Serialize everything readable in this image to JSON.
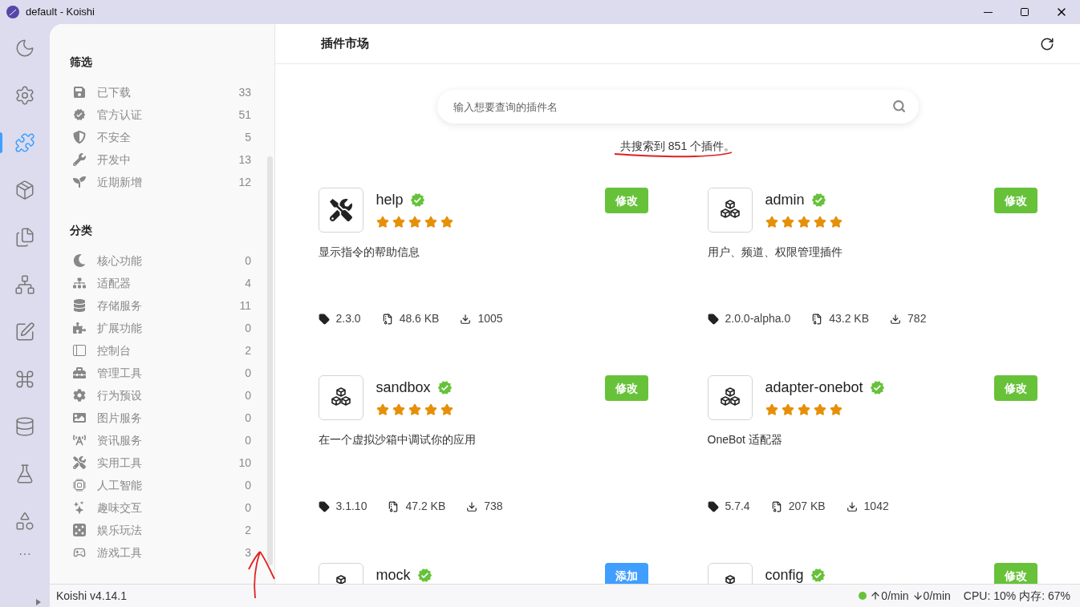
{
  "window": {
    "title": "default - Koishi"
  },
  "activity_bar": [
    {
      "selected": false
    },
    {
      "selected": false
    },
    {
      "selected": true
    },
    {
      "selected": false
    },
    {
      "selected": false
    },
    {
      "selected": false
    },
    {
      "selected": false
    },
    {
      "selected": false
    },
    {
      "selected": false
    },
    {
      "selected": false
    },
    {
      "selected": false
    }
  ],
  "more_label": "···",
  "sidebar": {
    "filter_title": "筛选",
    "filters": [
      {
        "label": "已下载",
        "count": "33"
      },
      {
        "label": "官方认证",
        "count": "51"
      },
      {
        "label": "不安全",
        "count": "5"
      },
      {
        "label": "开发中",
        "count": "13"
      },
      {
        "label": "近期新增",
        "count": "12"
      }
    ],
    "category_title": "分类",
    "categories": [
      {
        "label": "核心功能",
        "count": "0"
      },
      {
        "label": "适配器",
        "count": "4"
      },
      {
        "label": "存储服务",
        "count": "11"
      },
      {
        "label": "扩展功能",
        "count": "0"
      },
      {
        "label": "控制台",
        "count": "2"
      },
      {
        "label": "管理工具",
        "count": "0"
      },
      {
        "label": "行为预设",
        "count": "0"
      },
      {
        "label": "图片服务",
        "count": "0"
      },
      {
        "label": "资讯服务",
        "count": "0"
      },
      {
        "label": "实用工具",
        "count": "10"
      },
      {
        "label": "人工智能",
        "count": "0"
      },
      {
        "label": "趣味交互",
        "count": "0"
      },
      {
        "label": "娱乐玩法",
        "count": "2"
      },
      {
        "label": "游戏工具",
        "count": "3"
      }
    ]
  },
  "page": {
    "title": "插件市场",
    "search": {
      "placeholder": "输入想要查询的插件名"
    },
    "result_count": "共搜索到 851 个插件。"
  },
  "plugins": [
    {
      "name": "help",
      "kind": "tools",
      "verified": true,
      "stars": 5,
      "action": "修改",
      "installed": true,
      "description": "显示指令的帮助信息",
      "version": "2.3.0",
      "size": "48.6 KB",
      "downloads": "1005"
    },
    {
      "name": "admin",
      "kind": "cubes",
      "verified": true,
      "stars": 5,
      "action": "修改",
      "installed": true,
      "description": "用户、频道、权限管理插件",
      "version": "2.0.0-alpha.0",
      "size": "43.2 KB",
      "downloads": "782"
    },
    {
      "name": "sandbox",
      "kind": "cubes",
      "verified": true,
      "stars": 5,
      "action": "修改",
      "installed": true,
      "description": "在一个虚拟沙箱中调试你的应用",
      "version": "3.1.10",
      "size": "47.2 KB",
      "downloads": "738"
    },
    {
      "name": "adapter-onebot",
      "kind": "cubes",
      "verified": true,
      "stars": 5,
      "action": "修改",
      "installed": true,
      "description": "OneBot 适配器",
      "version": "5.7.4",
      "size": "207 KB",
      "downloads": "1042"
    },
    {
      "name": "mock",
      "kind": "cubes",
      "verified": true,
      "action": "添加",
      "installed": false
    },
    {
      "name": "config",
      "kind": "cubes",
      "verified": true,
      "action": "修改",
      "installed": true
    }
  ],
  "status_bar": {
    "version": "Koishi v4.14.1",
    "online": true,
    "upload": "0/min",
    "download": "0/min",
    "cpu": "CPU: 10%",
    "memory": "内存: 67%"
  }
}
